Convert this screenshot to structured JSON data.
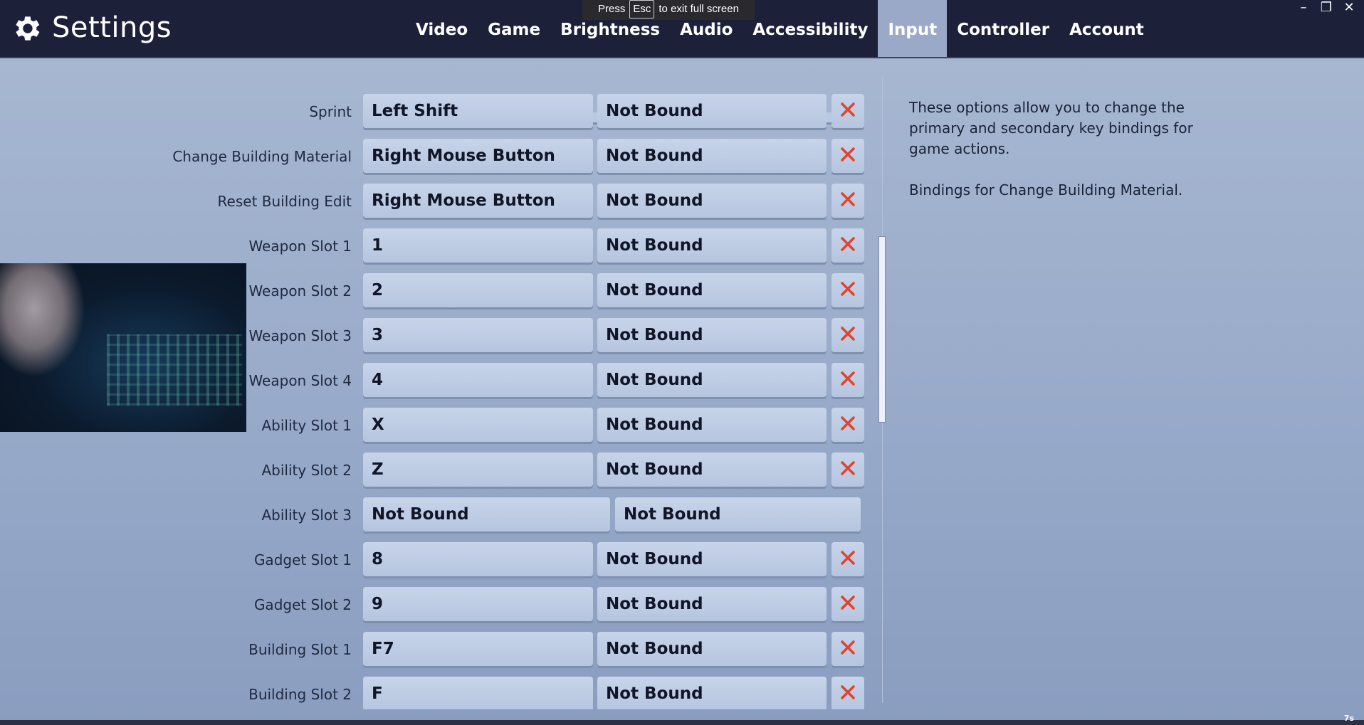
{
  "header": {
    "title": "Settings",
    "icon": "gear-icon",
    "tabs": [
      {
        "label": "Video",
        "active": false
      },
      {
        "label": "Game",
        "active": false
      },
      {
        "label": "Brightness",
        "active": false
      },
      {
        "label": "Audio",
        "active": false
      },
      {
        "label": "Accessibility",
        "active": false
      },
      {
        "label": "Input",
        "active": true
      },
      {
        "label": "Controller",
        "active": false
      },
      {
        "label": "Account",
        "active": false
      }
    ]
  },
  "fullscreen_banner": {
    "press": "Press",
    "key": "Esc",
    "suffix": "to exit full screen"
  },
  "window_controls": {
    "minimize": "–",
    "restore": "❐",
    "close": "✕"
  },
  "bindings": [
    {
      "action": "Sprint",
      "primary": "Left Shift",
      "secondary": "Not Bound",
      "clearable": true
    },
    {
      "action": "Change Building Material",
      "primary": "Right Mouse Button",
      "secondary": "Not Bound",
      "clearable": true
    },
    {
      "action": "Reset Building Edit",
      "primary": "Right Mouse Button",
      "secondary": "Not Bound",
      "clearable": true
    },
    {
      "action": "Weapon Slot 1",
      "primary": "1",
      "secondary": "Not Bound",
      "clearable": true
    },
    {
      "action": "Weapon Slot 2",
      "primary": "2",
      "secondary": "Not Bound",
      "clearable": true
    },
    {
      "action": "Weapon Slot 3",
      "primary": "3",
      "secondary": "Not Bound",
      "clearable": true
    },
    {
      "action": "Weapon Slot 4",
      "primary": "4",
      "secondary": "Not Bound",
      "clearable": true
    },
    {
      "action": "Ability Slot 1",
      "primary": "X",
      "secondary": "Not Bound",
      "clearable": true
    },
    {
      "action": "Ability Slot 2",
      "primary": "Z",
      "secondary": "Not Bound",
      "clearable": true
    },
    {
      "action": "Ability Slot 3",
      "primary": "Not Bound",
      "secondary": "Not Bound",
      "clearable": false
    },
    {
      "action": "Gadget Slot 1",
      "primary": "8",
      "secondary": "Not Bound",
      "clearable": true
    },
    {
      "action": "Gadget Slot 2",
      "primary": "9",
      "secondary": "Not Bound",
      "clearable": true
    },
    {
      "action": "Building Slot 1",
      "primary": "F7",
      "secondary": "Not Bound",
      "clearable": true
    },
    {
      "action": "Building Slot 2",
      "primary": "F",
      "secondary": "Not Bound",
      "clearable": true
    }
  ],
  "description": {
    "general": "These options allow you to change the primary and secondary key bindings for game actions.",
    "selected": "Bindings for Change Building Material."
  },
  "overlay": {
    "timer": "7s"
  },
  "colors": {
    "header_bg": "#1c2139",
    "clear_x": "#e0432f",
    "active_tab": "#9aa9c7"
  }
}
